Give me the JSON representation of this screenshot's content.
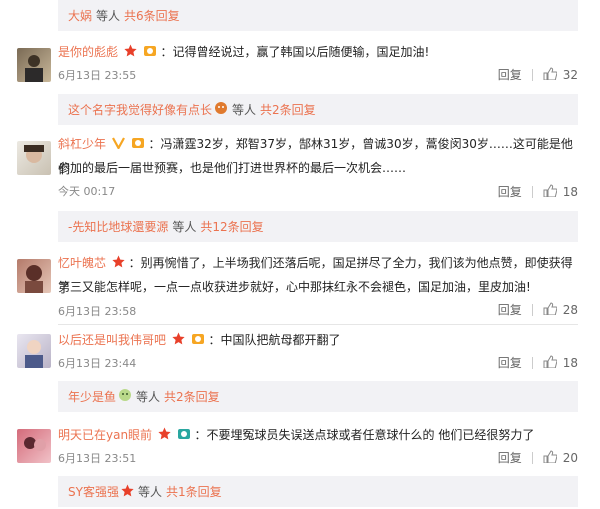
{
  "reply_bars": [
    {
      "name": "大娲",
      "text": "等人",
      "count": "共6条回复"
    },
    {
      "name": "这个名字我觉得好像有点长",
      "text": "等人",
      "count": "共2条回复"
    },
    {
      "name": "-先知比地球還要源",
      "text": "等人",
      "count": "共12条回复"
    },
    {
      "name": "年少是鱼",
      "text": "等人",
      "count": "共2条回复"
    },
    {
      "name": "SY客强强",
      "text": "等人",
      "count": "共1条回复"
    }
  ],
  "comments": [
    {
      "user": "是你的彪彪",
      "text": "：记得曾经说过，赢了韩国以后随便输，国足加油!",
      "line2": "",
      "date": "6月13日 23:55",
      "reply": "回复",
      "likes": "32"
    },
    {
      "user": "斜杠少年",
      "text": "：冯潇霆32岁，郑智37岁，郜林31岁，曾诚30岁，蒿俊闵30岁……这可能是他们",
      "line2": "参加的最后一届世预赛，也是他们打进世界杯的最后一次机会……",
      "date": "今天 00:17",
      "reply": "回复",
      "likes": "18"
    },
    {
      "user": "忆叶魄芯",
      "text": "：别再惋惜了，上半场我们还落后呢，国足拼尽了全力，我们该为他点赞，即使获得了",
      "line2": "第三又能怎样呢，一点一点收获进步就好，心中那抹红永不会褪色，国足加油，里皮加油!",
      "date": "6月13日 23:58",
      "reply": "回复",
      "likes": "28"
    },
    {
      "user": "以后还是叫我伟哥吧",
      "text": "：中国队把航母都开翻了",
      "line2": "",
      "date": "6月13日 23:44",
      "reply": "回复",
      "likes": "18"
    },
    {
      "user": "明天已在yan眼前",
      "text": "：不要埋冤球员失误送点球或者任意球什么的 他们已经很努力了",
      "line2": "",
      "date": "6月13日 23:51",
      "reply": "回复",
      "likes": "20"
    }
  ],
  "colors": {
    "username": "#eb7350",
    "reply_bg": "#f2f2f5"
  },
  "icons": [
    "star-badge-icon",
    "vip-badge-icon",
    "thumb-up-icon",
    "emoji-icon"
  ]
}
